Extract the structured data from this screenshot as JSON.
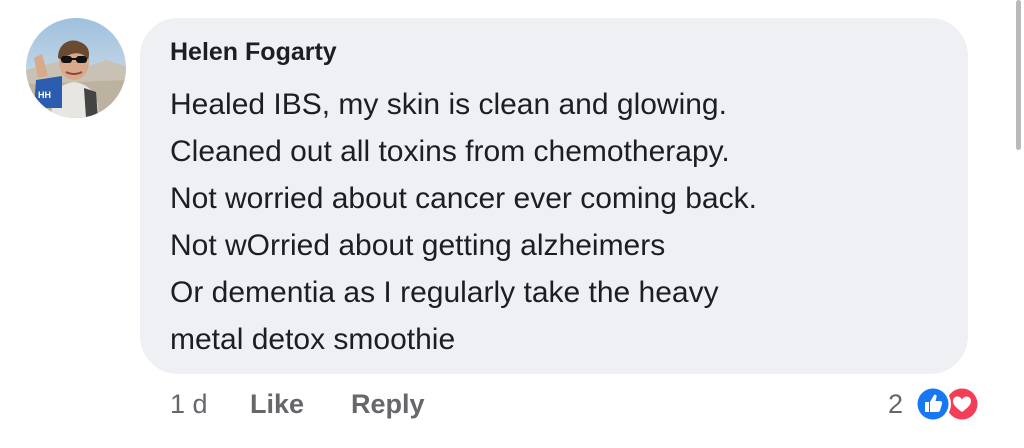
{
  "comment": {
    "author": "Helen Fogarty",
    "lines": [
      "Healed IBS, my skin is clean and glowing.",
      "Cleaned out all toxins from chemotherapy.",
      "Not worried about cancer ever coming back.",
      "Not wOrried about getting alzheimers",
      "Or dementia as I regularly take the heavy",
      "metal detox smoothie"
    ],
    "avatar_icon": "profile-photo",
    "avatar_badge_text": "HH"
  },
  "actions": {
    "timestamp": "1 d",
    "like_label": "Like",
    "reply_label": "Reply"
  },
  "reactions": {
    "count": "2",
    "types": [
      "like-icon",
      "love-icon"
    ]
  },
  "colors": {
    "bubble": "#eff0f4",
    "text": "#1c1e21",
    "meta_text": "#65676b",
    "like_blue": "#1877f2",
    "love_red": "#f33e58"
  }
}
